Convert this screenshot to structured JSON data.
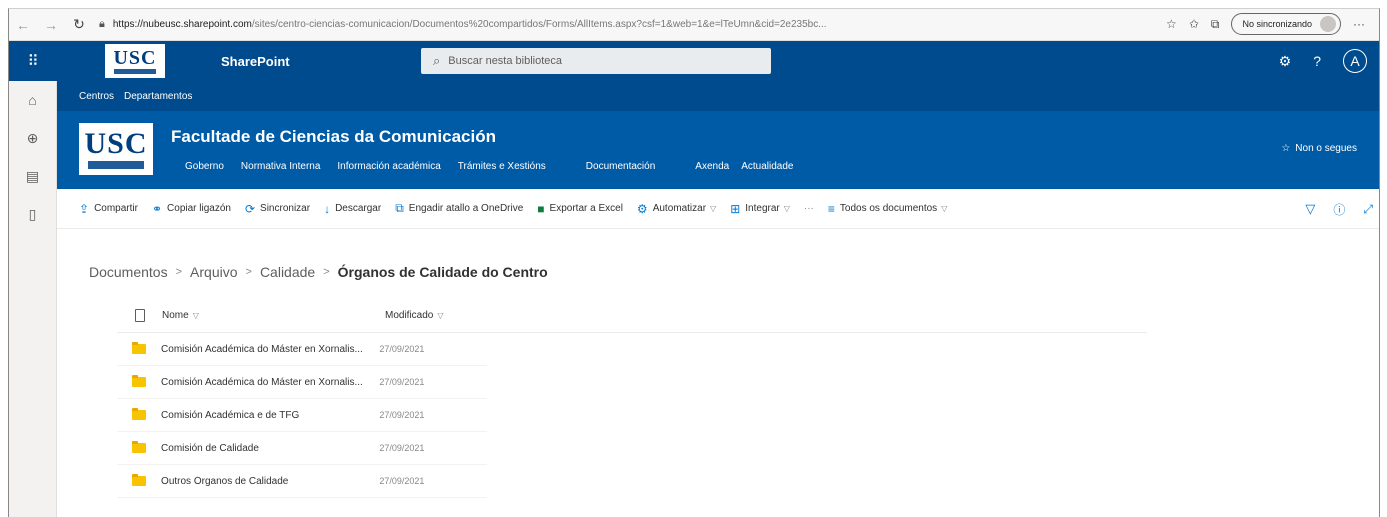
{
  "browser": {
    "url_host": "https://nubeusc.sharepoint.com",
    "url_path": "/sites/centro-ciencias-comunicacion/Documentos%20compartidos/Forms/AllItems.aspx?csf=1&web=1&e=lTeUmn&cid=2e235bc...",
    "sync_label": "No sincronizando"
  },
  "suite": {
    "logo_text": "USC",
    "app_name": "SharePoint",
    "search_placeholder": "Buscar nesta biblioteca",
    "avatar_initial": "A"
  },
  "hubnav": {
    "items": [
      "Centros",
      "Departamentos"
    ]
  },
  "site": {
    "logo_text": "USC",
    "title": "Facultade de Ciencias da Comunicación",
    "nav": [
      "Goberno",
      "Normativa Interna",
      "Información académica",
      "Trámites e Xestións",
      "Documentación",
      "Axenda",
      "Actualidade"
    ],
    "follow_label": "Non o segues"
  },
  "commands": {
    "share": "Compartir",
    "copy_link": "Copiar ligazón",
    "sync": "Sincronizar",
    "download": "Descargar",
    "add_shortcut": "Engadir atallo a OneDrive",
    "export_excel": "Exportar a Excel",
    "automate": "Automatizar",
    "integrate": "Integrar",
    "more": "···",
    "view": "Todos os documentos"
  },
  "breadcrumb": {
    "items": [
      "Documentos",
      "Arquivo",
      "Calidade"
    ],
    "current": "Órganos de Calidade do Centro"
  },
  "list": {
    "col_name": "Nome",
    "col_modified": "Modificado",
    "rows": [
      {
        "name": "Comisión Académica do Máster en Xornalis...",
        "modified": "27/09/2021"
      },
      {
        "name": "Comisión Académica do Máster en Xornalis...",
        "modified": "27/09/2021"
      },
      {
        "name": "Comisión Académica e de TFG",
        "modified": "27/09/2021"
      },
      {
        "name": "Comisión de Calidade",
        "modified": "27/09/2021"
      },
      {
        "name": "Outros Órganos de Calidade",
        "modified": "27/09/2021"
      }
    ]
  }
}
